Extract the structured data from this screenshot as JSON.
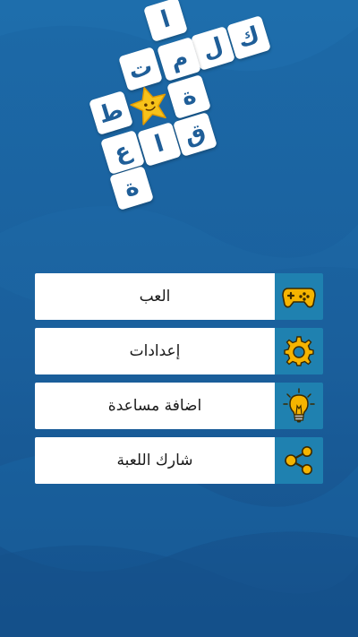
{
  "logo": {
    "letters": [
      "ا",
      "ك",
      "ل",
      "م",
      "ت",
      "ط",
      "ة",
      "ق",
      "ا",
      "ع",
      "ة"
    ],
    "mascot": "star-mascot-icon"
  },
  "menu": {
    "items": [
      {
        "label": "العب",
        "icon": "gamepad-icon"
      },
      {
        "label": "إعدادات",
        "icon": "gear-icon"
      },
      {
        "label": "اضافة مساعدة",
        "icon": "lightbulb-icon"
      },
      {
        "label": "شارك اللعبة",
        "icon": "share-icon"
      }
    ]
  },
  "colors": {
    "background": "#1a5f9c",
    "icon_panel": "#1f81b0",
    "icon_fill": "#f5b400",
    "tile_text": "#1f5e98"
  }
}
